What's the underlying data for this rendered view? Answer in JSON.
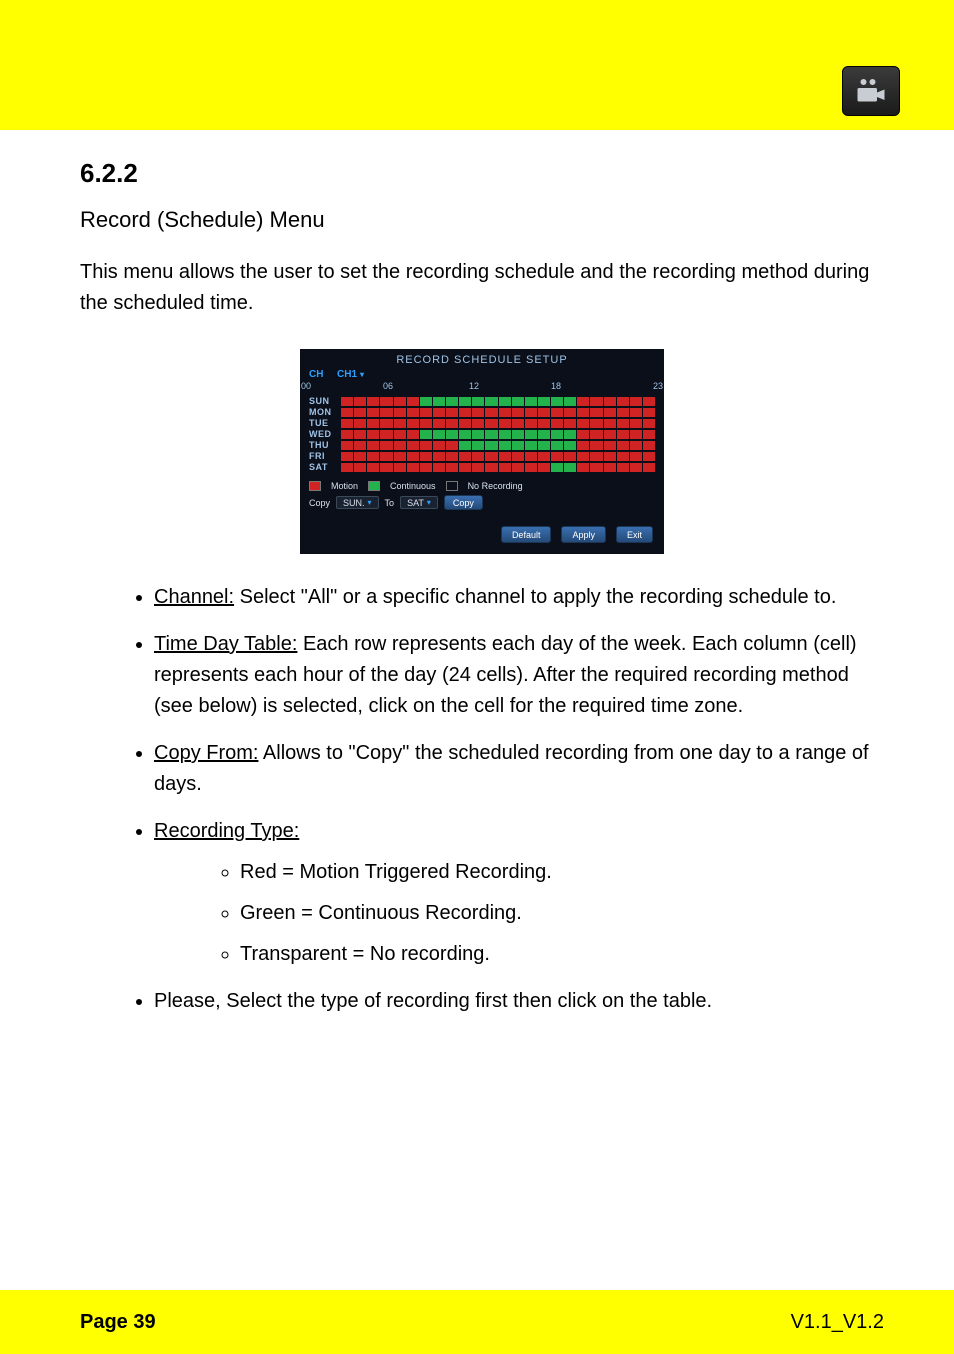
{
  "header": {
    "icon_name": "camera-icon"
  },
  "section": {
    "number": "6.2.2",
    "title": "Record (Schedule) Menu",
    "intro": "This menu allows the user to set the recording schedule and the recording method during the scheduled time."
  },
  "screenshot": {
    "title": "RECORD  SCHEDULE  SETUP",
    "ch_label": "CH",
    "ch_value": "CH1",
    "hours": [
      "00",
      "06",
      "12",
      "18",
      "23"
    ],
    "days": [
      "SUN",
      "MON",
      "TUE",
      "WED",
      "THU",
      "FRI",
      "SAT"
    ],
    "schedule": {
      "SUN": [
        "r",
        "r",
        "r",
        "r",
        "r",
        "r",
        "g",
        "g",
        "g",
        "g",
        "g",
        "g",
        "g",
        "g",
        "g",
        "g",
        "g",
        "g",
        "r",
        "r",
        "r",
        "r",
        "r",
        "r"
      ],
      "MON": [
        "r",
        "r",
        "r",
        "r",
        "r",
        "r",
        "r",
        "r",
        "r",
        "r",
        "r",
        "r",
        "r",
        "r",
        "r",
        "r",
        "r",
        "r",
        "r",
        "r",
        "r",
        "r",
        "r",
        "r"
      ],
      "TUE": [
        "r",
        "r",
        "r",
        "r",
        "r",
        "r",
        "r",
        "r",
        "r",
        "r",
        "r",
        "r",
        "r",
        "r",
        "r",
        "r",
        "r",
        "r",
        "r",
        "r",
        "r",
        "r",
        "r",
        "r"
      ],
      "WED": [
        "r",
        "r",
        "r",
        "r",
        "r",
        "r",
        "g",
        "g",
        "g",
        "g",
        "g",
        "g",
        "g",
        "g",
        "g",
        "g",
        "g",
        "g",
        "r",
        "r",
        "r",
        "r",
        "r",
        "r"
      ],
      "THU": [
        "r",
        "r",
        "r",
        "r",
        "r",
        "r",
        "r",
        "r",
        "r",
        "g",
        "g",
        "g",
        "g",
        "g",
        "g",
        "g",
        "g",
        "g",
        "r",
        "r",
        "r",
        "r",
        "r",
        "r"
      ],
      "FRI": [
        "r",
        "r",
        "r",
        "r",
        "r",
        "r",
        "r",
        "r",
        "r",
        "r",
        "r",
        "r",
        "r",
        "r",
        "r",
        "r",
        "r",
        "r",
        "r",
        "r",
        "r",
        "r",
        "r",
        "r"
      ],
      "SAT": [
        "r",
        "r",
        "r",
        "r",
        "r",
        "r",
        "r",
        "r",
        "r",
        "r",
        "r",
        "r",
        "r",
        "r",
        "r",
        "r",
        "g",
        "g",
        "r",
        "r",
        "r",
        "r",
        "r",
        "r"
      ]
    },
    "legend": {
      "motion": "Motion",
      "continuous": "Continuous",
      "none": "No  Recording"
    },
    "copy": {
      "label": "Copy",
      "from": "SUN.",
      "to_label": "To",
      "to": "SAT",
      "btn": "Copy"
    },
    "buttons": {
      "default": "Default",
      "apply": "Apply",
      "exit": "Exit"
    }
  },
  "bullets": {
    "channel_lead": "Channel:",
    "channel_text": " Select \"All\" or a specific channel to apply the recording schedule to.",
    "timegrid_lead": "Time Day Table:",
    "timegrid_text": " Each row represents each day of the week. Each column (cell) represents each hour of the day (24 cells). After the required recording method (see below) is selected, click on the cell for the required time zone.",
    "copy_lead": "Copy From:",
    "copy_text": " Allows to \"Copy\" the scheduled recording from one day to a range of days.",
    "method_lead": "Recording  Type:",
    "method_items": {
      "motion": "Red = Motion Triggered Recording.",
      "continuous": "Green = Continuous Recording.",
      "none": "Transparent = No recording."
    },
    "method_note": "Please, Select the type of recording first then click on the table."
  },
  "footer": {
    "left": "Page 39",
    "right": "V1.1_V1.2"
  }
}
